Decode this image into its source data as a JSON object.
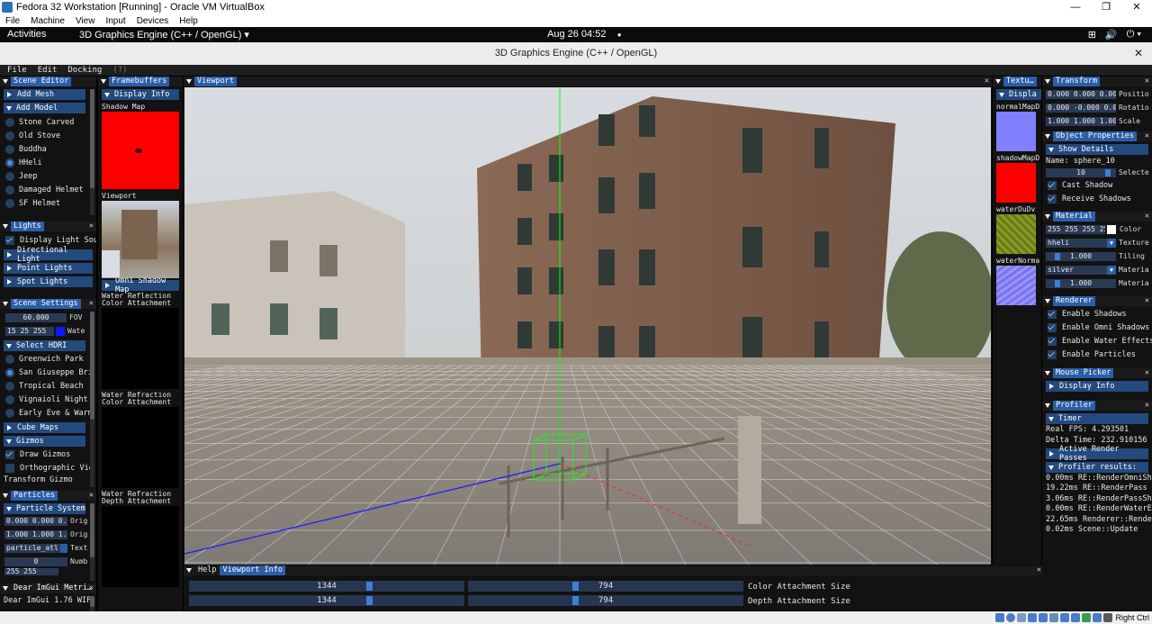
{
  "window": {
    "title": "Fedora 32 Workstation [Running] - Oracle VM VirtualBox",
    "controls": [
      "—",
      "❐",
      "✕"
    ]
  },
  "vb_menu": [
    "File",
    "Machine",
    "View",
    "Input",
    "Devices",
    "Help"
  ],
  "gnome": {
    "activities": "Activities",
    "app": "3D Graphics Engine (C++ / OpenGL) ▾",
    "clock": "Aug 26  04:52",
    "dot": "●",
    "tray": [
      "⊞",
      "🔊",
      "⏻ ▾"
    ]
  },
  "app_title": "3D Graphics Engine (C++ / OpenGL)",
  "app_close": "✕",
  "imgui_menu": [
    "File",
    "Edit",
    "Docking"
  ],
  "imgui_menu_help": "(?)",
  "scene_editor": {
    "tab": "Scene Editor",
    "add_mesh": "Add Mesh",
    "add_model": "Add Model",
    "models": [
      "Stone Carved",
      "Old Stove",
      "Buddha",
      "HHeli",
      "Jeep",
      "Damaged Helmet",
      "SF Helmet"
    ]
  },
  "lights": {
    "tab": "Lights",
    "close": "✕",
    "display": "Display Light Sour",
    "items": [
      "Directional Light",
      "Point Lights",
      "Spot Lights"
    ]
  },
  "scene_settings": {
    "tab": "Scene Settings",
    "close": "✕",
    "fov_value": "60.000",
    "fov_label": "FOV",
    "water_rgb": "15  25  255",
    "water_label": "Wate",
    "hdri_header": "Select HDRI",
    "hdri": [
      "Greenwich Park",
      "San Giuseppe Bri",
      "Tropical Beach",
      "Vignaioli Night",
      "Early Eve & Warm"
    ],
    "cube_maps": "Cube Maps",
    "gizmos": "Gizmos",
    "draw_gizmos": "Draw Gizmos",
    "ortho": "Orthographic Vie",
    "transform_gizmo": "Transform Gizmo"
  },
  "particles": {
    "tab": "Particles",
    "close": "✕",
    "system": "Particle System",
    "orig1": "0.000 0.000 0.000",
    "orig1_lbl": "Orig",
    "orig2": "1.000 1.000 1.000",
    "orig2_lbl": "Orig",
    "texture": "particle_atl",
    "texture_lbl": "Text",
    "num": "0",
    "num_lbl": "Numb",
    "extra": "255  255"
  },
  "dear_imgui": {
    "tab": "Dear ImGui Metri…",
    "close": "✕",
    "text": "Dear ImGui 1.76 WIP"
  },
  "framebuffers": {
    "tab": "Framebuffers",
    "display_info": "Display Info",
    "shadow_map": "Shadow Map",
    "viewport": "Viewport",
    "omni": "Omni Shadow Map",
    "water_refl": "Water Reflection\nColor Attachment",
    "water_refr": "Water Refraction\nColor Attachment",
    "water_depth": "Water Refraction\nDepth Attachment"
  },
  "viewport": {
    "tab": "Viewport",
    "close": "✕"
  },
  "bottom": {
    "tabs": [
      "Help",
      "Viewport Info"
    ],
    "close": "✕",
    "color_w": "1344",
    "color_h": "794",
    "color_lbl": "Color Attachment Size",
    "depth_w": "1344",
    "depth_h": "794",
    "depth_lbl": "Depth Attachment Size"
  },
  "textures": {
    "tab": "Textu…",
    "display": "Displa",
    "items": [
      "normalMapD",
      "shadowMapD",
      "waterDuDv",
      "waterNorma"
    ]
  },
  "transform": {
    "tab": "Transform",
    "close": "✕",
    "pos": "0.000 0.000 0.000",
    "pos_lbl": "Positio",
    "rot": "0.000 -0.000 0.000",
    "rot_lbl": "Rotatio",
    "scale": "1.000 1.000 1.000",
    "scale_lbl": "Scale"
  },
  "object_props": {
    "tab": "Object Properties",
    "close": "✕",
    "show": "Show Details",
    "name": "Name: sphere_10",
    "sel_value": "10",
    "sel_lbl": "Selecte",
    "cast": "Cast Shadow",
    "receive": "Receive Shadows"
  },
  "material": {
    "tab": "Material",
    "close": "✕",
    "color_vals": "255 255 255 255",
    "color_lbl": "Color",
    "texture": "hheli",
    "texture_lbl": "Texture",
    "tiling": "1.000",
    "tiling_lbl": "Tiling",
    "mat": "silver",
    "mat_lbl": "Materia",
    "mat2": "1.000",
    "mat2_lbl": "Materia"
  },
  "renderer": {
    "tab": "Renderer",
    "close": "✕",
    "items": [
      "Enable Shadows",
      "Enable Omni Shadows",
      "Enable Water Effects",
      "Enable Particles"
    ]
  },
  "mouse_picker": {
    "tab": "Mouse Picker",
    "close": "✕",
    "display": "Display Info"
  },
  "profiler": {
    "tab": "Profiler",
    "close": "✕",
    "timer": "Timer",
    "fps": "Real FPS: 4.293501",
    "delta": "Delta Time: 232.910156 ms",
    "active": "Active Render Passes",
    "results": "Profiler results:",
    "lines": [
      "0.00ms RE::RenderOmniShad",
      "19.22ms RE::RenderPass",
      "3.06ms RE::RenderPassShad",
      "0.00ms RE::RenderWaterEff",
      "22.65ms Renderer::Render",
      "0.02ms Scene::Update"
    ]
  },
  "statusbar": {
    "right_ctrl": "Right Ctrl"
  },
  "colors": {
    "accent": "#2a5ea8",
    "header": "#234a7e",
    "check": "#4a8fe0"
  }
}
